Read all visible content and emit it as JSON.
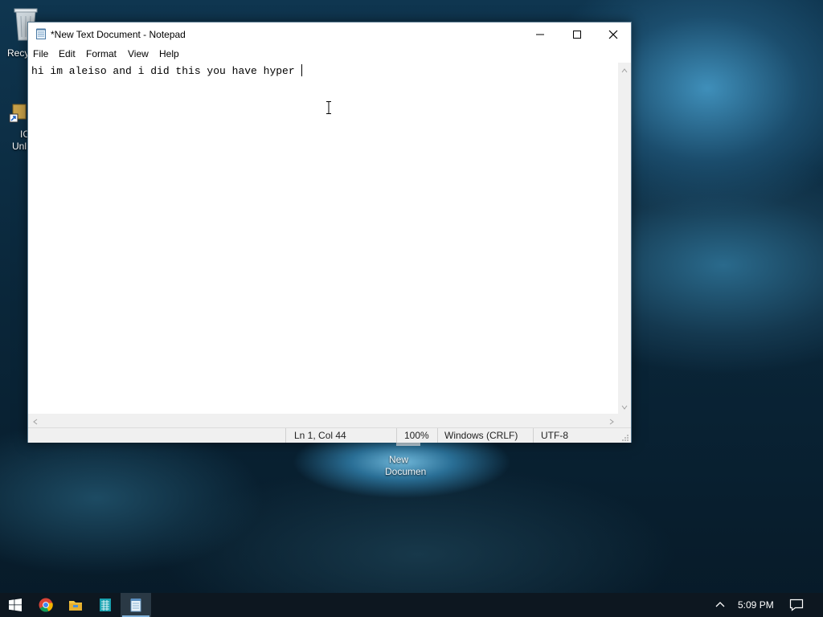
{
  "desktop": {
    "icons": [
      {
        "label": "Recy",
        "icon": "recycle-bin-icon"
      },
      {
        "label_line1": "IC",
        "label_line2": "Unl",
        "icon": "shortcut-icon"
      },
      {
        "label_line1": "New",
        "label_line2": "Documen",
        "icon": "text-file-icon"
      }
    ]
  },
  "notepad": {
    "title": "*New Text Document - Notepad",
    "menu": [
      "File",
      "Edit",
      "Format",
      "View",
      "Help"
    ],
    "content": "hi im aleiso and i did this you have hyper ",
    "status": {
      "position": "Ln 1, Col 44",
      "zoom": "100%",
      "line_ending": "Windows (CRLF)",
      "encoding": "UTF-8"
    }
  },
  "taskbar": {
    "apps": [
      "windows-start-icon",
      "chrome-icon",
      "file-explorer-icon",
      "spreadsheet-icon",
      "notepad-icon"
    ],
    "active_app": "notepad-icon",
    "clock": "5:09 PM"
  },
  "colors": {
    "taskbar": "#0d1720",
    "active_indicator": "#7fb0d8",
    "window_border": "#5a7a90"
  }
}
